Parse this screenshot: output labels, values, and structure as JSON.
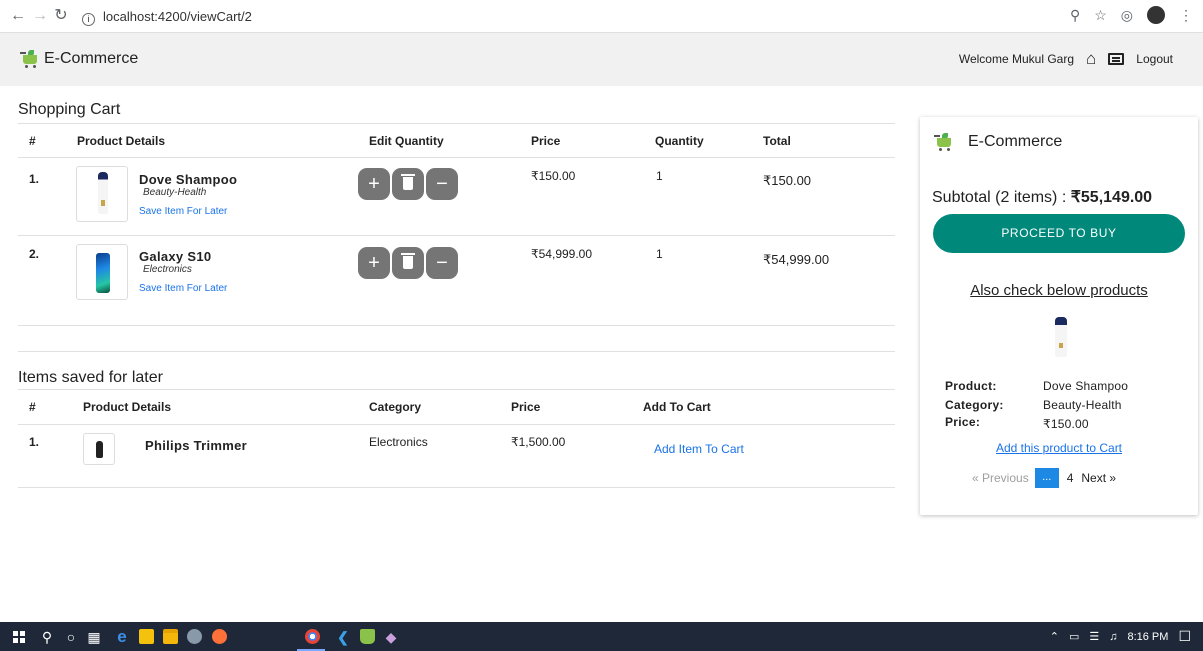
{
  "browser": {
    "url": "localhost:4200/viewCart/2"
  },
  "header": {
    "brand": "E-Commerce",
    "welcome": "Welcome Mukul Garg",
    "logout": "Logout"
  },
  "cart": {
    "title": "Shopping Cart",
    "columns": [
      "#",
      "Product Details",
      "Edit Quantity",
      "Price",
      "Quantity",
      "Total"
    ],
    "items": [
      {
        "index": "1.",
        "name": "Dove Shampoo",
        "category": "Beauty-Health",
        "save_link": "Save Item For Later",
        "price": "₹150.00",
        "quantity": "1",
        "total": "₹150.00"
      },
      {
        "index": "2.",
        "name": "Galaxy S10",
        "category": "Electronics",
        "save_link": "Save Item For Later",
        "price": "₹54,999.00",
        "quantity": "1",
        "total": "₹54,999.00"
      }
    ]
  },
  "saved": {
    "title": "Items saved for later",
    "columns": [
      "#",
      "Product Details",
      "Category",
      "Price",
      "Add To Cart"
    ],
    "items": [
      {
        "index": "1.",
        "name": "Philips Trimmer",
        "category": "Electronics",
        "price": "₹1,500.00",
        "add_link": "Add Item To Cart"
      }
    ]
  },
  "sidebar": {
    "brand": "E-Commerce",
    "subtotal_label": "Subtotal (2 items) : ",
    "subtotal_value": "₹55,149.00",
    "buy_button": "PROCEED TO BUY",
    "also_title": "Also check below products",
    "recommend": {
      "product_label": "Product:",
      "product_value": "Dove Shampoo",
      "category_label": "Category:",
      "category_value": "Beauty-Health",
      "price_label": "Price:",
      "price_value": "₹150.00",
      "add_link": "Add this product to Cart"
    },
    "pager": {
      "prev": "« Previous",
      "current": "...",
      "page": "4",
      "next": "Next »"
    }
  },
  "taskbar": {
    "time": "8:16 PM"
  },
  "colors": {
    "accent_teal": "#00897b",
    "link_blue": "#1a73e8",
    "pager_blue": "#1e88e5",
    "qty_button": "#757575",
    "header_bg": "#f1f1f1",
    "taskbar_bg": "#1f2839"
  }
}
